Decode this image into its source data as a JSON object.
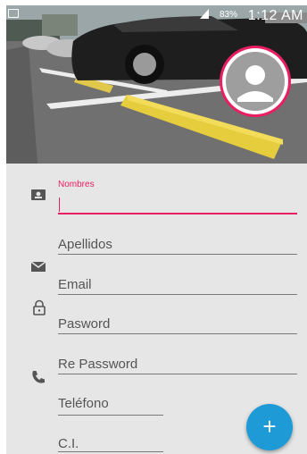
{
  "status_bar": {
    "battery": "83%",
    "time": "1:12 AM"
  },
  "form": {
    "fields": [
      {
        "label": "Nombres"
      },
      {
        "label": "Apellidos"
      },
      {
        "label": "Email"
      },
      {
        "label": "Pasword"
      },
      {
        "label": "Re Password"
      },
      {
        "label": "Teléfono"
      },
      {
        "label": "C.I."
      }
    ]
  },
  "fab": {
    "glyph": "+"
  },
  "colors": {
    "accent": "#e91e63",
    "fab": "#1e9bd7",
    "background": "#e6e6e6"
  },
  "icons": [
    "notification-icon",
    "signal-icon",
    "profile-placeholder-icon",
    "contact-card-icon",
    "mail-icon",
    "lock-icon",
    "phone-icon",
    "add-icon"
  ]
}
